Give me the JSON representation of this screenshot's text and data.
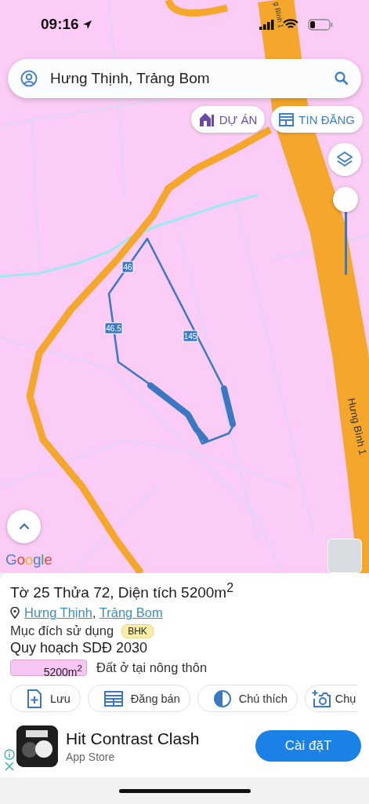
{
  "status_bar": {
    "time": "09:16"
  },
  "search": {
    "value": "Hưng Thịnh, Trảng Bom"
  },
  "chips": [
    {
      "label": "DỰ ÁN",
      "kind": "project"
    },
    {
      "label": "TIN ĐĂNG",
      "kind": "listing"
    }
  ],
  "map": {
    "labels": [
      "g Bình 1",
      "46",
      "46.5",
      "145",
      "Hưng Bình 1"
    ],
    "zoom_slider": {
      "level": 1
    },
    "logo": "Google"
  },
  "parcel": {
    "title": "Tờ 25 Thửa 72, Diện tích 5200m$^{2}$",
    "location_links": [
      "Hưng Thịnh",
      "Trảng Bom"
    ],
    "separator": ",",
    "usage_label": "Mục đích sử dụng",
    "usage_badge": "BHK",
    "plan_title": "Quy hoạch SDĐ 2030",
    "legend": [
      {
        "area": "5200m$^{2}$",
        "color": "#f8c6f3",
        "label": "Đất ở tại nông thôn"
      }
    ]
  },
  "actions": [
    {
      "label": "Lưu",
      "kind": "save"
    },
    {
      "label": "Đăng bán",
      "kind": "post"
    },
    {
      "label": "Chú thích",
      "kind": "legend"
    },
    {
      "label": "Chụ",
      "kind": "capture"
    }
  ],
  "ad": {
    "app_name": "Hit Contrast Clash",
    "store": "App Store",
    "button": "Cài đặT"
  }
}
